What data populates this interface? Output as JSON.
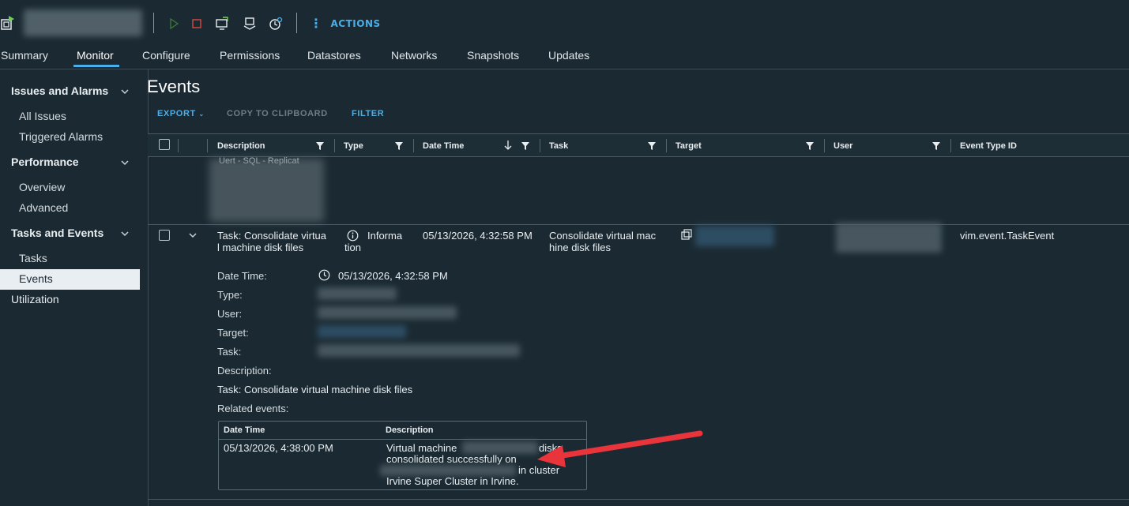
{
  "toolbar": {
    "actions_label": "ACTIONS"
  },
  "tabs": [
    "Summary",
    "Monitor",
    "Configure",
    "Permissions",
    "Datastores",
    "Networks",
    "Snapshots",
    "Updates"
  ],
  "sidebar": {
    "issues": {
      "title": "Issues and Alarms",
      "items": [
        "All Issues",
        "Triggered Alarms"
      ]
    },
    "performance": {
      "title": "Performance",
      "items": [
        "Overview",
        "Advanced"
      ]
    },
    "tasks": {
      "title": "Tasks and Events",
      "items": [
        "Tasks",
        "Events"
      ]
    },
    "utilization": "Utilization"
  },
  "page": {
    "title": "Events",
    "export": "EXPORT",
    "copy": "COPY TO CLIPBOARD",
    "filter": "FILTER"
  },
  "grid": {
    "columns": [
      "Description",
      "Type",
      "Date Time",
      "Task",
      "Target",
      "User",
      "Event Type ID"
    ],
    "top_row_fragment": "Uert - SQL - Replicat",
    "row": {
      "description": "Task: Consolidate virtual machine disk files",
      "type": "Information",
      "datetime": "05/13/2026, 4:32:58 PM",
      "task": "Consolidate virtual machine disk files",
      "event_type_id": "vim.event.TaskEvent"
    },
    "details": {
      "labels": [
        "Date Time:",
        "Type:",
        "User:",
        "Target:",
        "Task:",
        "Description:"
      ],
      "datetime_value": "05/13/2026, 4:32:58 PM",
      "description_value": "Task: Consolidate virtual machine disk files",
      "related_label": "Related events:",
      "related": {
        "headers": [
          "Date Time",
          "Description"
        ],
        "datetime": "05/13/2026, 4:38:00 PM",
        "desc_line1": "Virtual machine",
        "desc_line1_tail": "disks",
        "desc_line2": "consolidated successfully on",
        "desc_line3_tail": "in cluster",
        "desc_line4": "Irvine Super Cluster in Irvine."
      }
    }
  },
  "colors": {
    "background": "#1b2a32",
    "accent": "#4aaee8",
    "arrow": "#e8343a"
  }
}
